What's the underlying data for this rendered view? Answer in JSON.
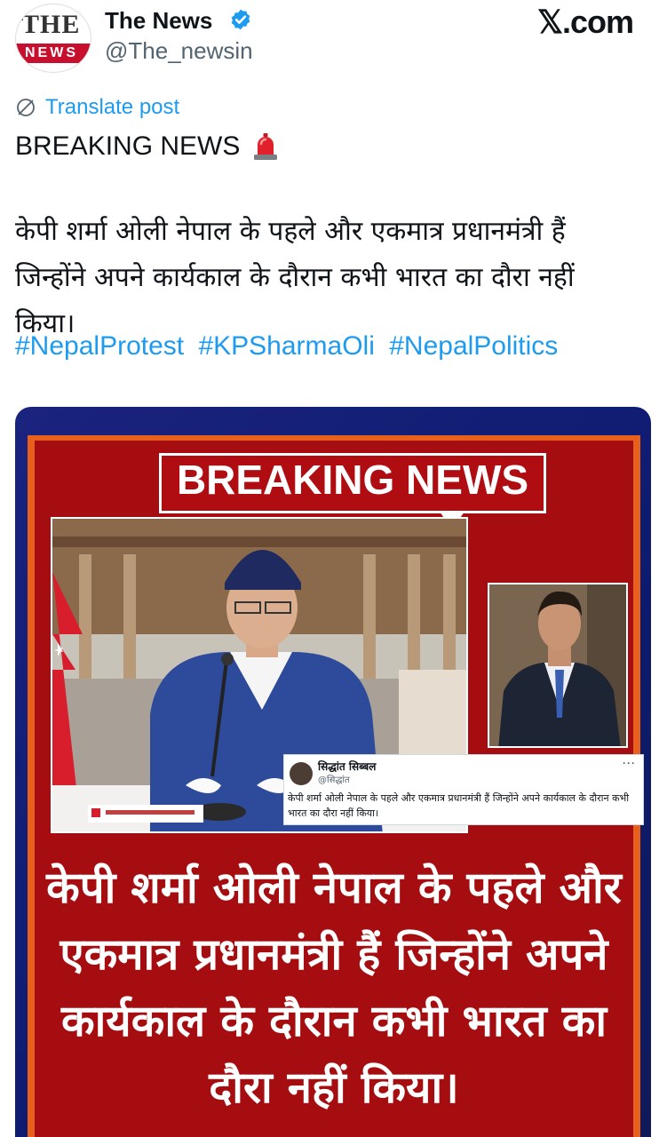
{
  "author": {
    "name": "The News",
    "handle": "@The_newsin",
    "avatar_text_top": "THE",
    "avatar_text_bottom": "NEWS",
    "verified": true
  },
  "site": "𝕏.com",
  "translate_label": "Translate post",
  "post": {
    "headline": "BREAKING NEWS",
    "headline_icon": "siren-icon",
    "body": "केपी शर्मा ओली नेपाल के पहले और एकमात्र प्रधानमंत्री हैं जिन्होंने अपने कार्यकाल के दौरान कभी भारत का दौरा नहीं किया।",
    "hashtags": [
      "#NepalProtest",
      "#KPSharmaOli",
      "#NepalPolitics"
    ]
  },
  "media": {
    "banner": "BREAKING NEWS",
    "embedded_tweet": {
      "name": "सिद्धांत सिब्बल",
      "handle": "@सिद्धांत",
      "more": "···",
      "text": "केपी शर्मा ओली नेपाल के पहले और एकमात्र प्रधानमंत्री हैं जिन्होंने अपने कार्यकाल के दौरान कभी भारत का दौरा नहीं किया।"
    },
    "caption": "केपी शर्मा ओली नेपाल के पहले और एकमात्र प्रधानमंत्री हैं जिन्होंने अपने कार्यकाल के दौरान कभी भारत का दौरा नहीं किया।"
  },
  "colors": {
    "link": "#1d9bf0",
    "verified": "#1d9bf0",
    "banner_red": "#a50d10",
    "frame_orange": "#e8601c"
  }
}
